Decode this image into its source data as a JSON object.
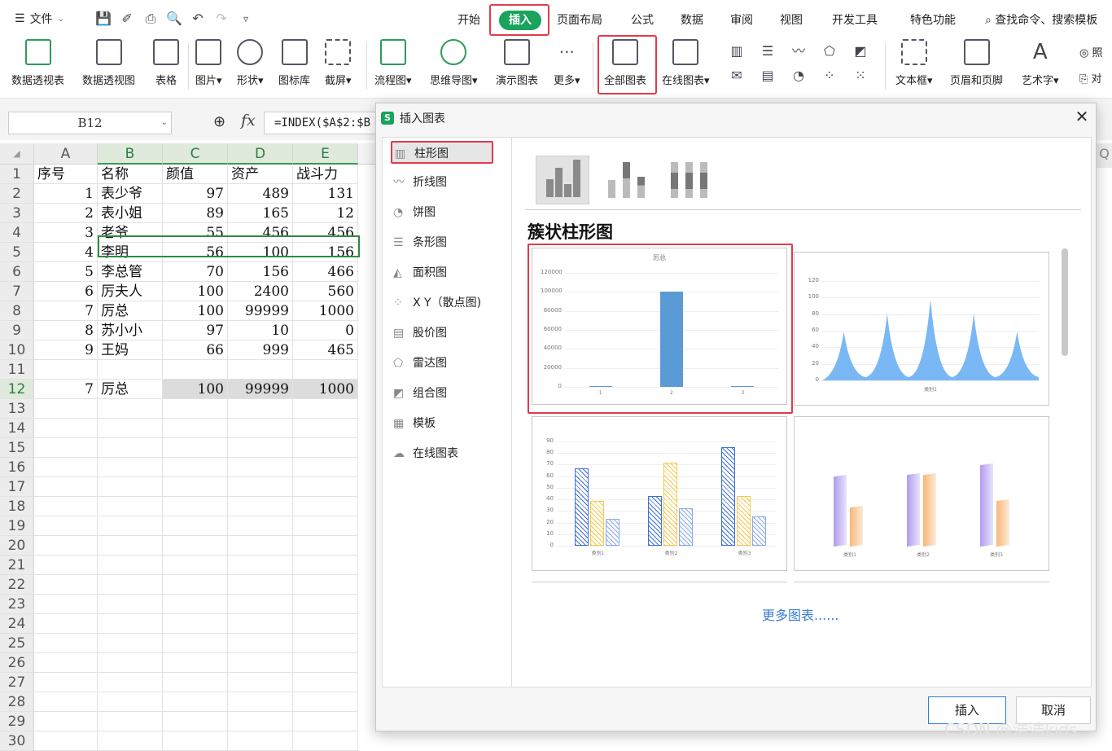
{
  "menubar": {
    "file": "文件",
    "tabs": [
      "开始",
      "插入",
      "页面布局",
      "公式",
      "数据",
      "审阅",
      "视图",
      "开发工具",
      "特色功能"
    ],
    "active_tab": "插入",
    "search": "查找命令、搜索模板"
  },
  "ribbon": {
    "items": [
      "数据透视表",
      "数据透视图",
      "表格",
      "图片",
      "形状",
      "图标库",
      "截屏",
      "流程图",
      "思维导图",
      "演示图表",
      "更多",
      "全部图表",
      "在线图表",
      "文本框",
      "页眉和页脚",
      "艺术字",
      "照",
      "对"
    ]
  },
  "formula": {
    "name_box": "B12",
    "fx": "fx",
    "content": "=INDEX($A$2:$B"
  },
  "sheet": {
    "columns": [
      "A",
      "B",
      "C",
      "D",
      "E"
    ],
    "row_numbers": [
      "1",
      "2",
      "3",
      "4",
      "5",
      "6",
      "7",
      "8",
      "9",
      "10",
      "11",
      "12",
      "13",
      "14",
      "15",
      "16",
      "17",
      "18",
      "19",
      "20",
      "21",
      "22",
      "23",
      "24",
      "25",
      "26",
      "27",
      "28",
      "29",
      "30"
    ],
    "header": [
      "序号",
      "名称",
      "颜值",
      "资产",
      "战斗力"
    ],
    "rows": [
      [
        "1",
        "表少爷",
        "97",
        "489",
        "131"
      ],
      [
        "2",
        "表小姐",
        "89",
        "165",
        "12"
      ],
      [
        "3",
        "老爷",
        "55",
        "456",
        "456"
      ],
      [
        "4",
        "李明",
        "56",
        "100",
        "156"
      ],
      [
        "5",
        "李总管",
        "70",
        "156",
        "466"
      ],
      [
        "6",
        "厉夫人",
        "100",
        "2400",
        "560"
      ],
      [
        "7",
        "厉总",
        "100",
        "99999",
        "1000"
      ],
      [
        "8",
        "苏小小",
        "97",
        "10",
        "0"
      ],
      [
        "9",
        "王妈",
        "66",
        "999",
        "465"
      ]
    ],
    "selected_row": [
      "7",
      "厉总",
      "100",
      "99999",
      "1000"
    ]
  },
  "dialog": {
    "title": "插入图表",
    "categories": [
      "柱形图",
      "折线图",
      "饼图",
      "条形图",
      "面积图",
      "X Y（散点图)",
      "股价图",
      "雷达图",
      "组合图",
      "模板",
      "在线图表"
    ],
    "selected_category": "柱形图",
    "section_title": "簇状柱形图",
    "more_charts": "更多图表......",
    "insert_button": "插入",
    "cancel_button": "取消"
  },
  "chart_data": [
    {
      "type": "bar",
      "title": "厉总",
      "categories": [
        "1",
        "2",
        "3"
      ],
      "values": [
        100,
        99999,
        1000
      ],
      "yticks": [
        "0",
        "20000",
        "40000",
        "60000",
        "80000",
        "100000",
        "120000"
      ],
      "ylim": [
        0,
        120000
      ],
      "color": "#5b9bd5"
    },
    {
      "type": "area",
      "categories": [
        "类别1"
      ],
      "yticks": [
        "0",
        "20",
        "40",
        "60",
        "80",
        "100",
        "120"
      ],
      "ylim": [
        0,
        120
      ],
      "color": "#7ab8f5"
    },
    {
      "type": "bar",
      "categories": [
        "类别1",
        "类别2",
        "类别3"
      ],
      "series": [
        {
          "values": [
            67,
            43,
            85
          ],
          "color": "#3d6fd9"
        },
        {
          "values": [
            39,
            72,
            43
          ],
          "color": "#f2c94c"
        },
        {
          "values": [
            23,
            32,
            25
          ],
          "color": "#8aaae8"
        }
      ],
      "yticks": [
        "0",
        "10",
        "20",
        "30",
        "40",
        "50",
        "60",
        "70",
        "80",
        "90"
      ],
      "ylim": [
        0,
        90
      ]
    },
    {
      "type": "bar",
      "categories": [
        "类别1",
        "类别2",
        "类别3"
      ],
      "series": [
        {
          "values": [
            4.3,
            4.4,
            5.0
          ],
          "color": "#b09cf0"
        },
        {
          "values": [
            2.4,
            4.4,
            2.8
          ],
          "color": "#f7b77a"
        }
      ]
    }
  ],
  "watermark": "CSDN @浩浩kids"
}
